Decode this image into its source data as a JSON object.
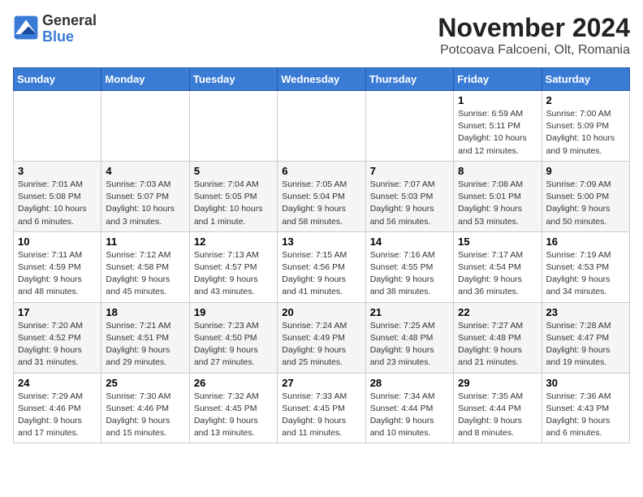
{
  "header": {
    "logo_line1": "General",
    "logo_line2": "Blue",
    "month": "November 2024",
    "location": "Potcoava Falcoeni, Olt, Romania"
  },
  "days_of_week": [
    "Sunday",
    "Monday",
    "Tuesday",
    "Wednesday",
    "Thursday",
    "Friday",
    "Saturday"
  ],
  "weeks": [
    [
      {
        "day": "",
        "info": ""
      },
      {
        "day": "",
        "info": ""
      },
      {
        "day": "",
        "info": ""
      },
      {
        "day": "",
        "info": ""
      },
      {
        "day": "",
        "info": ""
      },
      {
        "day": "1",
        "info": "Sunrise: 6:59 AM\nSunset: 5:11 PM\nDaylight: 10 hours and 12 minutes."
      },
      {
        "day": "2",
        "info": "Sunrise: 7:00 AM\nSunset: 5:09 PM\nDaylight: 10 hours and 9 minutes."
      }
    ],
    [
      {
        "day": "3",
        "info": "Sunrise: 7:01 AM\nSunset: 5:08 PM\nDaylight: 10 hours and 6 minutes."
      },
      {
        "day": "4",
        "info": "Sunrise: 7:03 AM\nSunset: 5:07 PM\nDaylight: 10 hours and 3 minutes."
      },
      {
        "day": "5",
        "info": "Sunrise: 7:04 AM\nSunset: 5:05 PM\nDaylight: 10 hours and 1 minute."
      },
      {
        "day": "6",
        "info": "Sunrise: 7:05 AM\nSunset: 5:04 PM\nDaylight: 9 hours and 58 minutes."
      },
      {
        "day": "7",
        "info": "Sunrise: 7:07 AM\nSunset: 5:03 PM\nDaylight: 9 hours and 56 minutes."
      },
      {
        "day": "8",
        "info": "Sunrise: 7:08 AM\nSunset: 5:01 PM\nDaylight: 9 hours and 53 minutes."
      },
      {
        "day": "9",
        "info": "Sunrise: 7:09 AM\nSunset: 5:00 PM\nDaylight: 9 hours and 50 minutes."
      }
    ],
    [
      {
        "day": "10",
        "info": "Sunrise: 7:11 AM\nSunset: 4:59 PM\nDaylight: 9 hours and 48 minutes."
      },
      {
        "day": "11",
        "info": "Sunrise: 7:12 AM\nSunset: 4:58 PM\nDaylight: 9 hours and 45 minutes."
      },
      {
        "day": "12",
        "info": "Sunrise: 7:13 AM\nSunset: 4:57 PM\nDaylight: 9 hours and 43 minutes."
      },
      {
        "day": "13",
        "info": "Sunrise: 7:15 AM\nSunset: 4:56 PM\nDaylight: 9 hours and 41 minutes."
      },
      {
        "day": "14",
        "info": "Sunrise: 7:16 AM\nSunset: 4:55 PM\nDaylight: 9 hours and 38 minutes."
      },
      {
        "day": "15",
        "info": "Sunrise: 7:17 AM\nSunset: 4:54 PM\nDaylight: 9 hours and 36 minutes."
      },
      {
        "day": "16",
        "info": "Sunrise: 7:19 AM\nSunset: 4:53 PM\nDaylight: 9 hours and 34 minutes."
      }
    ],
    [
      {
        "day": "17",
        "info": "Sunrise: 7:20 AM\nSunset: 4:52 PM\nDaylight: 9 hours and 31 minutes."
      },
      {
        "day": "18",
        "info": "Sunrise: 7:21 AM\nSunset: 4:51 PM\nDaylight: 9 hours and 29 minutes."
      },
      {
        "day": "19",
        "info": "Sunrise: 7:23 AM\nSunset: 4:50 PM\nDaylight: 9 hours and 27 minutes."
      },
      {
        "day": "20",
        "info": "Sunrise: 7:24 AM\nSunset: 4:49 PM\nDaylight: 9 hours and 25 minutes."
      },
      {
        "day": "21",
        "info": "Sunrise: 7:25 AM\nSunset: 4:48 PM\nDaylight: 9 hours and 23 minutes."
      },
      {
        "day": "22",
        "info": "Sunrise: 7:27 AM\nSunset: 4:48 PM\nDaylight: 9 hours and 21 minutes."
      },
      {
        "day": "23",
        "info": "Sunrise: 7:28 AM\nSunset: 4:47 PM\nDaylight: 9 hours and 19 minutes."
      }
    ],
    [
      {
        "day": "24",
        "info": "Sunrise: 7:29 AM\nSunset: 4:46 PM\nDaylight: 9 hours and 17 minutes."
      },
      {
        "day": "25",
        "info": "Sunrise: 7:30 AM\nSunset: 4:46 PM\nDaylight: 9 hours and 15 minutes."
      },
      {
        "day": "26",
        "info": "Sunrise: 7:32 AM\nSunset: 4:45 PM\nDaylight: 9 hours and 13 minutes."
      },
      {
        "day": "27",
        "info": "Sunrise: 7:33 AM\nSunset: 4:45 PM\nDaylight: 9 hours and 11 minutes."
      },
      {
        "day": "28",
        "info": "Sunrise: 7:34 AM\nSunset: 4:44 PM\nDaylight: 9 hours and 10 minutes."
      },
      {
        "day": "29",
        "info": "Sunrise: 7:35 AM\nSunset: 4:44 PM\nDaylight: 9 hours and 8 minutes."
      },
      {
        "day": "30",
        "info": "Sunrise: 7:36 AM\nSunset: 4:43 PM\nDaylight: 9 hours and 6 minutes."
      }
    ]
  ]
}
